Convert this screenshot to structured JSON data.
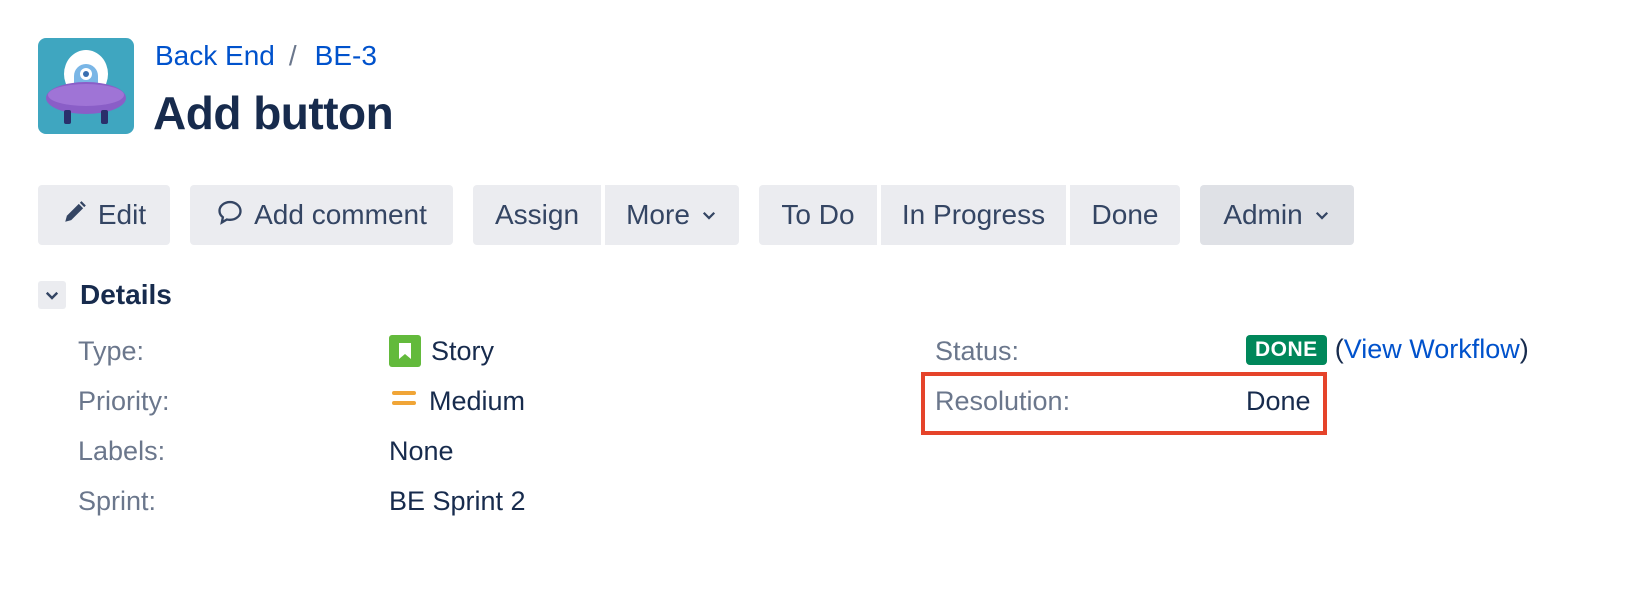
{
  "breadcrumb": {
    "project": "Back End",
    "separator": "/",
    "issue_key": "BE-3"
  },
  "issue": {
    "title": "Add button"
  },
  "toolbar": {
    "edit": "Edit",
    "add_comment": "Add comment",
    "assign": "Assign",
    "more": "More",
    "to_do": "To Do",
    "in_progress": "In Progress",
    "done": "Done",
    "admin": "Admin"
  },
  "details": {
    "heading": "Details",
    "type_label": "Type:",
    "type_value": "Story",
    "priority_label": "Priority:",
    "priority_value": "Medium",
    "labels_label": "Labels:",
    "labels_value": "None",
    "sprint_label": "Sprint:",
    "sprint_value": "BE Sprint 2",
    "status_label": "Status:",
    "status_value": "DONE",
    "view_workflow_open": "(",
    "view_workflow": "View Workflow",
    "view_workflow_close": ")",
    "resolution_label": "Resolution:",
    "resolution_value": "Done"
  },
  "colors": {
    "link": "#0052cc",
    "status_done": "#00875a",
    "story": "#63ba3c",
    "priority_medium": "#f0a537",
    "highlight": "#e5432a"
  },
  "icons": [
    "project-avatar-icon",
    "pencil-icon",
    "comment-icon",
    "chevron-down-icon",
    "story-icon",
    "priority-medium-icon"
  ]
}
